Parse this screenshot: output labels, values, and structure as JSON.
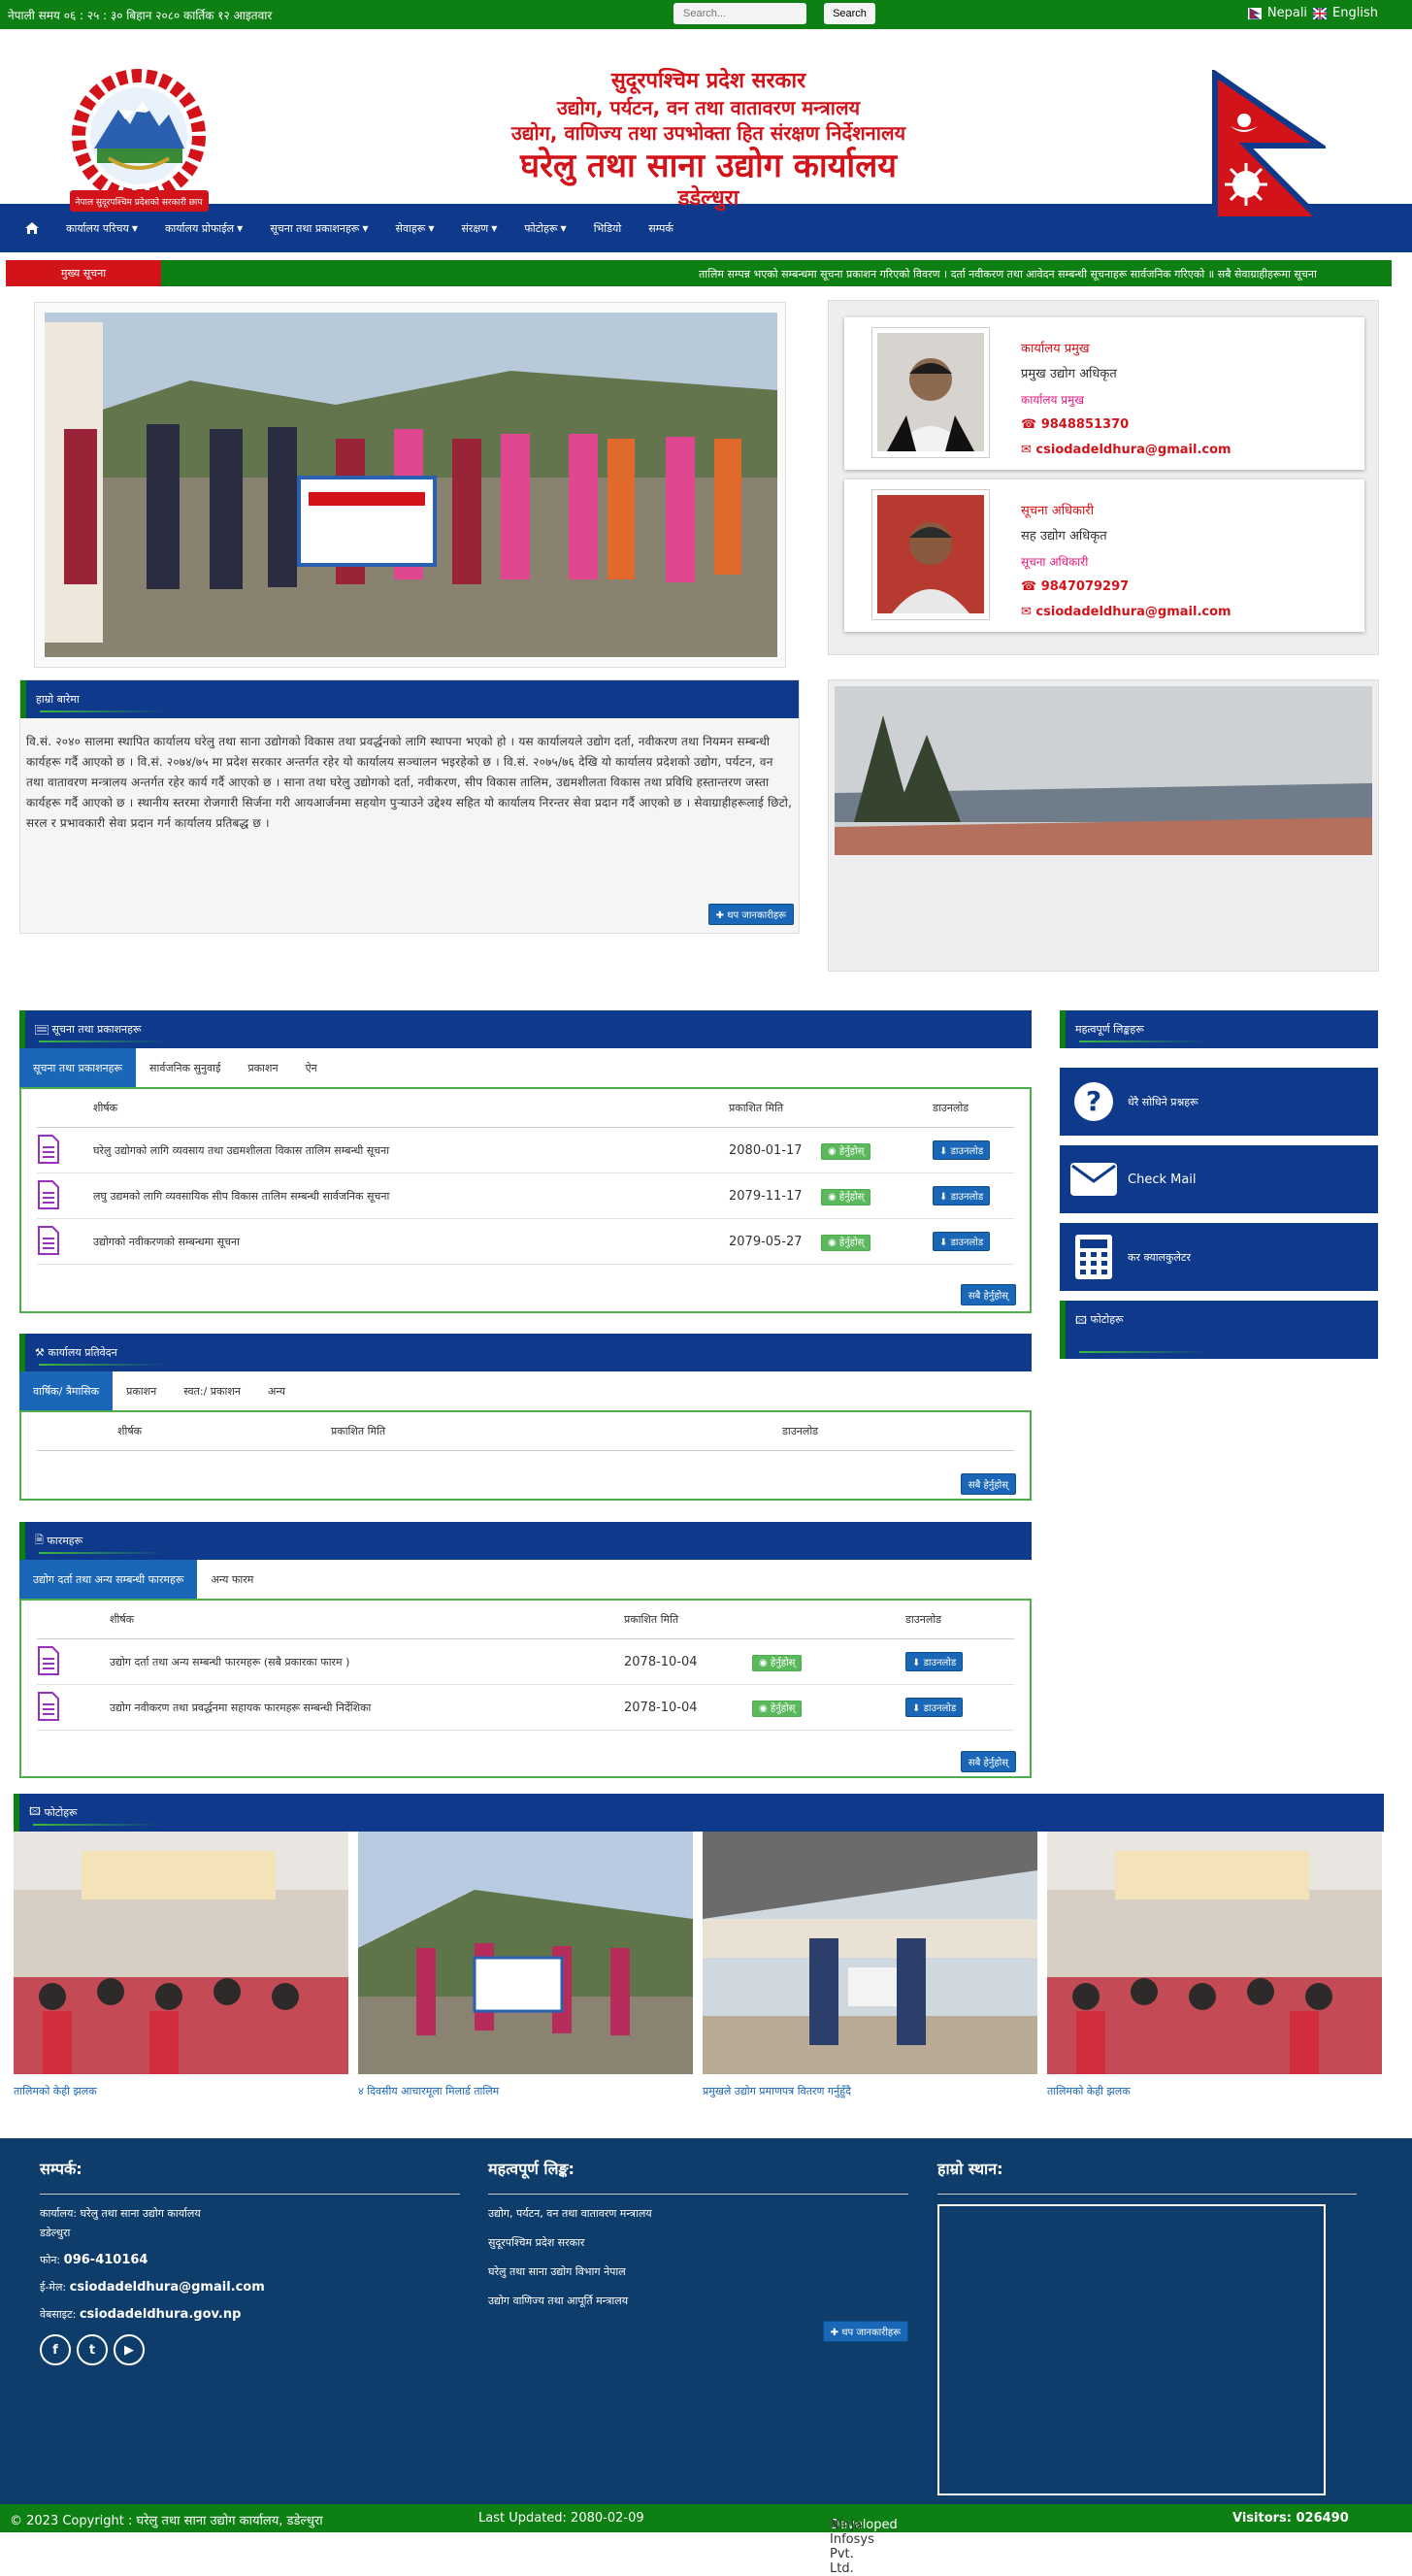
{
  "topbar": {
    "time": "नेपाली समय ०६ : २५ : ३० बिहान   २०८० कार्तिक १२ आइतवार",
    "search_placeholder": "Search...",
    "search_button": "Search",
    "lang_nepali": "Nepali",
    "lang_english": "English"
  },
  "header": {
    "line1": "सुदूरपश्चिम प्रदेश सरकार",
    "line2": "उद्योग, पर्यटन, वन तथा वातावरण मन्त्रालय",
    "line3": "उद्योग, वाणिज्य तथा उपभोक्ता हित संरक्षण निर्देशनालय",
    "line4": "घरेलु तथा साना उद्योग कार्यालय",
    "line5": "डडेल्धुरा",
    "emblem_caption": "नेपाल सुदूरपश्चिम प्रदेशको सरकारी छाप"
  },
  "nav": {
    "items": [
      "कार्यालय परिचय",
      "कार्यालय प्रोफाईल",
      "सूचना तथा प्रकाशनहरू",
      "सेवाहरू",
      "संरक्षण",
      "फोटोहरू",
      "भिडियो",
      "सम्पर्क"
    ],
    "has_caret": [
      true,
      true,
      true,
      true,
      true,
      true,
      false,
      false
    ]
  },
  "ticker": {
    "label": "मुख्य सूचना",
    "text": "तालिम सम्पन्न भएको सम्बन्धमा  सूचना प्रकाशन गरिएको विवरण ।  दर्ता नवीकरण तथा आवेदन सम्बन्धी सूचनाहरू सार्वजनिक गरिएको ॥ सबै सेवाग्राहीहरूमा सूचना"
  },
  "contacts": [
    {
      "name": "कार्यालय प्रमुख",
      "role": "प्रमुख उद्योग अधिकृत",
      "sub": "कार्यालय प्रमुख",
      "phone": "9848851370",
      "email": "csiodadeldhura@gmail.com"
    },
    {
      "name": "सूचना अधिकारी",
      "role": "सह उद्योग अधिकृत",
      "sub": "सूचना अधिकारी",
      "phone": "9847079297",
      "email": "csiodadeldhura@gmail.com"
    }
  ],
  "about": {
    "title": "हाम्रो बारेमा",
    "body": "वि.सं. २०४० सालमा स्थापित कार्यालय घरेलु तथा साना उद्योगको विकास तथा प्रवर्द्धनको लागि स्थापना भएको हो । यस कार्यालयले उद्योग दर्ता, नवीकरण तथा नियमन सम्बन्धी कार्यहरू गर्दै आएको छ । वि.सं. २०७४/७५ मा प्रदेश सरकार अन्तर्गत रहेर यो कार्यालय सञ्चालन भइरहेको छ । वि.सं. २०७५/७६ देखि यो कार्यालय प्रदेशको उद्योग, पर्यटन, वन तथा वातावरण मन्त्रालय अन्तर्गत रहेर कार्य गर्दै आएको छ । साना तथा घरेलु उद्योगको दर्ता, नवीकरण, सीप विकास तालिम, उद्यमशीलता विकास तथा प्रविधि हस्तान्तरण जस्ता कार्यहरू गर्दै आएको छ । स्थानीय स्तरमा रोजगारी सिर्जना गरी आयआर्जनमा सहयोग पुर्‍याउने उद्देश्य सहित यो कार्यालय निरन्तर सेवा प्रदान गर्दै आएको छ । सेवाग्राहीहरूलाई छिटो, सरल र प्रभावकारी सेवा प्रदान गर्न कार्यालय प्रतिबद्ध छ ।",
    "more": "थप जानकारीहरू"
  },
  "notices": {
    "title": "सूचना तथा प्रकाशनहरू",
    "tabs": [
      "सूचना तथा प्रकाशनहरू",
      "सार्वजनिक सुनुवाई",
      "प्रकाशन",
      "ऐन"
    ],
    "headers": [
      "शीर्षक",
      "प्रकाशित मिति",
      "डाउनलोड"
    ],
    "rows": [
      {
        "title": "घरेलु उद्योगको लागि व्यवसाय तथा उद्यमशीलता विकास तालिम सम्बन्धी सूचना",
        "date": "2080-01-17"
      },
      {
        "title": "लघु उद्यमको लागि व्यवसायिक सीप विकास तालिम सम्बन्धी सार्वजनिक सूचना",
        "date": "2079-11-17"
      },
      {
        "title": "उद्योगको नवीकरणको सम्बन्धमा सूचना",
        "date": "2079-05-27"
      }
    ],
    "view_label": "हेर्नुहोस्",
    "download_label": "डाउनलोड",
    "all_label": "सबै हेर्नुहोस्"
  },
  "reports": {
    "title": "कार्यालय प्रतिवेदन",
    "tabs": [
      "वार्षिक/ त्रैमासिक",
      "प्रकाशन",
      "स्वत:/ प्रकाशन",
      "अन्य"
    ],
    "headers": [
      "शीर्षक",
      "प्रकाशित मिति",
      "डाउनलोड"
    ],
    "all_label": "सबै हेर्नुहोस्"
  },
  "forms": {
    "title": "फारमहरू",
    "tabs": [
      "उद्योग दर्ता तथा अन्य सम्बन्धी फारमहरू",
      "अन्य फारम"
    ],
    "headers": [
      "शीर्षक",
      "प्रकाशित मिति",
      "डाउनलोड"
    ],
    "rows": [
      {
        "title": "उद्योग दर्ता तथा अन्य सम्बन्धी फारमहरू (सबै प्रकारका फारम )",
        "date": "2078-10-04"
      },
      {
        "title": "उद्योग नवीकरण तथा प्रवर्द्धनमा सहायक फारमहरू सम्बन्धी निर्देशिका",
        "date": "2078-10-04"
      }
    ],
    "view_label": "हेर्नुहोस्",
    "download_label": "डाउनलोड",
    "all_label": "सबै हेर्नुहोस्"
  },
  "sidebar": {
    "title": "महत्वपूर्ण लिङ्कहरू",
    "links": [
      {
        "label": "धेरै सोधिने प्रश्नहरू",
        "icon": "question-icon"
      },
      {
        "label": "Check Mail",
        "icon": "mail-icon"
      },
      {
        "label": "कर क्यालकुलेटर",
        "icon": "calculator-icon"
      }
    ],
    "gallery_title": "फोटोहरू"
  },
  "gallery": {
    "title": "फोटोहरू",
    "captions": [
      "तालिमको केही झलक",
      "४ दिवसीय आचारमूला मिलार्ड तालिम",
      "प्रमुखले उद्योग प्रमाणपत्र वितरण गर्नुहुँदै",
      "तालिमको केही झलक"
    ]
  },
  "footer": {
    "col1_title": "सम्पर्क:",
    "office": "कार्यालय: घरेलु तथा साना उद्योग कार्यालय",
    "office2": "डडेल्धुरा",
    "phone_label": "फोन:",
    "phone": "096-410164",
    "email_label": "ई-मेल:",
    "email": "csiodadeldhura@gmail.com",
    "web_label": "वेबसाइट:",
    "web": "csiodadeldhura.gov.np",
    "col2_title": "महत्वपूर्ण लिङ्क:",
    "links": [
      "उद्योग, पर्यटन, वन तथा वातावरण मन्त्रालय",
      "सुदूरपश्चिम प्रदेश सरकार",
      "घरेलु तथा साना उद्योग विभाग नेपाल",
      "उद्योग वाणिज्य तथा आपूर्ति मन्त्रालय"
    ],
    "links_more": "थप जानकारीहरू",
    "col3_title": "हाम्रो स्थान:"
  },
  "bottombar": {
    "copyright": "© 2023 Copyright : घरेलु तथा साना उद्योग कार्यालय, डडेल्धुरा",
    "updated": "Last Updated: 2080-02-09",
    "developed_label": "Developed By:",
    "developer": "Ninja Infosys Pvt. Ltd.",
    "visitors": "Visitors: 026490"
  },
  "colors": {
    "green": "#0e7f12",
    "blue": "#0f3a8c",
    "red": "#d2141a",
    "footer": "#0e3d6b"
  }
}
